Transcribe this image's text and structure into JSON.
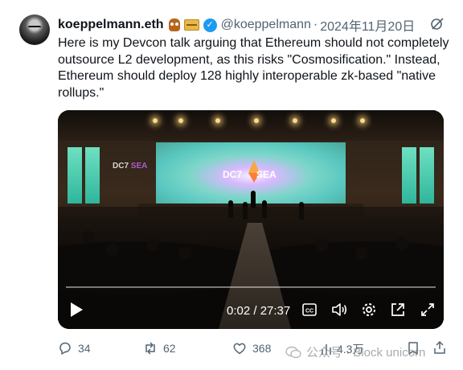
{
  "header": {
    "name": "koeppelmann.eth",
    "handle": "@koeppelmann",
    "separator": "·",
    "date": "2024年11月20日"
  },
  "tweet": {
    "text": "Here is my Devcon talk arguing that Ethereum should not completely outsource L2 development, as this risks \"Cosmosification.\" Instead, Ethereum should deploy 128 highly interoperable zk-based \"native rollups.\""
  },
  "video": {
    "time": "0:02 / 27:37",
    "screen_left": "DC7",
    "screen_right": "SEA",
    "side_logo_left": "DC7",
    "side_logo_right": "SEA",
    "progress": 0.001,
    "icons": [
      "play-icon",
      "closed-captions-icon",
      "volume-icon",
      "settings-gear-icon",
      "popout-icon",
      "fullscreen-icon"
    ]
  },
  "actions": {
    "replies": "34",
    "reposts": "62",
    "likes": "368",
    "views": "4.3万"
  },
  "watermark": {
    "text": "公众号 · Block unicorn"
  },
  "colors": {
    "text": "#0f1419",
    "secondary": "#536471",
    "verified": "#1d9bf0"
  }
}
